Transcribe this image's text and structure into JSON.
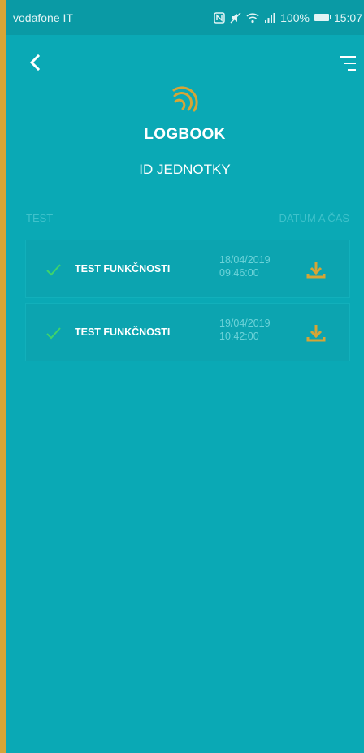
{
  "status_bar": {
    "carrier": "vodafone IT",
    "battery": "100%",
    "time": "15:07"
  },
  "header": {
    "back_icon": "chevron-left-icon",
    "menu_icon": "filter-menu-icon",
    "logo_icon": "wireless-signal-icon",
    "title": "LOGBOOK",
    "subtitle": "ID JEDNOTKY"
  },
  "columns": {
    "test": "TEST",
    "datetime": "DATUM A ČAS"
  },
  "rows": [
    {
      "name": "TEST FUNKČNOSTI",
      "date": "18/04/2019",
      "time": "09:46:00",
      "status_icon": "check-icon",
      "action_icon": "download-icon"
    },
    {
      "name": "TEST FUNKČNOSTI",
      "date": "19/04/2019",
      "time": "10:42:00",
      "status_icon": "check-icon",
      "action_icon": "download-icon"
    }
  ],
  "colors": {
    "background": "#0aa9b5",
    "accent": "#d6a536",
    "check": "#3fd46a"
  }
}
